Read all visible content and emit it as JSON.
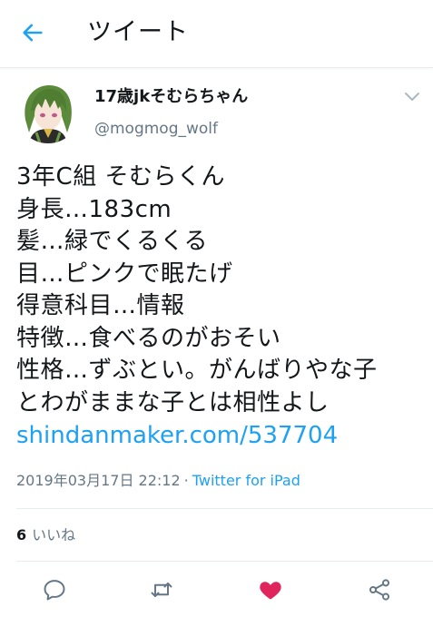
{
  "header": {
    "back_icon": "arrow-left-icon",
    "title": "ツイート"
  },
  "tweet": {
    "author": {
      "display_name": "17歳jkそむらちゃん",
      "handle": "@mogmog_wolf",
      "avatar": "anime-character-avatar"
    },
    "caret_icon": "chevron-down-icon",
    "lines": [
      "3年C組 そむらくん",
      "身長…183cm",
      "髪…緑でくるくる",
      "目…ピンクで眠たげ",
      "得意科目…情報",
      "特徴…食べるのがおそい",
      "性格…ずぶとい。がんばりやな子",
      "とわがままな子とは相性よし"
    ],
    "link": "shindanmaker.com/537704",
    "timestamp": "2019年03月17日 22:12",
    "separator": "·",
    "source": "Twitter for iPad",
    "likes": {
      "count": "6",
      "label": "いいね"
    }
  },
  "actions": {
    "reply_icon": "reply-icon",
    "retweet_icon": "retweet-icon",
    "like_icon": "heart-icon",
    "share_icon": "share-icon"
  },
  "colors": {
    "accent": "#1da1f2",
    "like": "#e0245e",
    "muted": "#657786",
    "icon": "#657786",
    "text": "#14171a",
    "divider": "#e6ecf0"
  }
}
